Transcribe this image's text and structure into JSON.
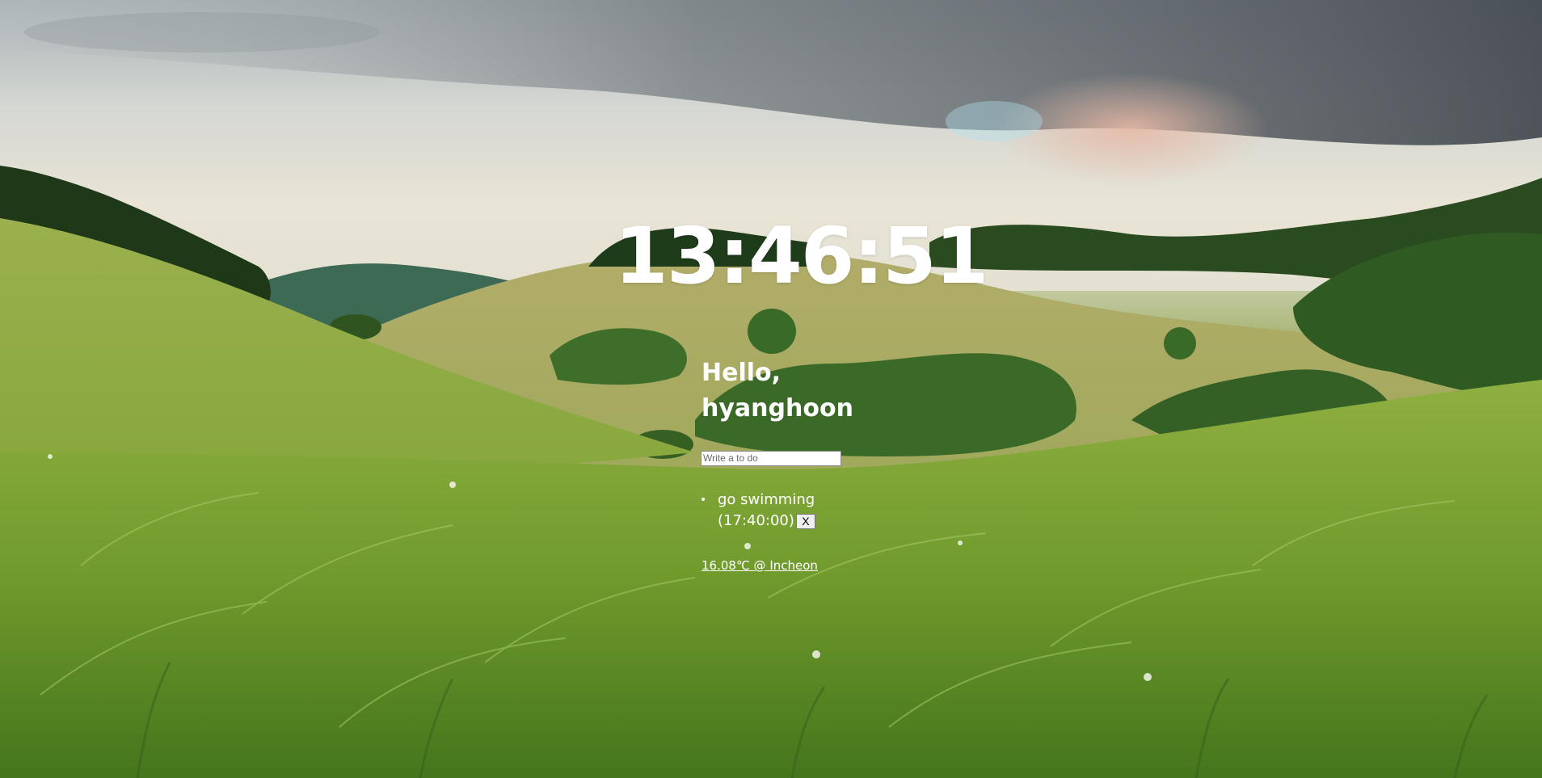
{
  "clock": {
    "time": "13:46:51"
  },
  "greeting": {
    "text": "Hello, hyanghoon"
  },
  "todo_form": {
    "placeholder": "Write a to do"
  },
  "todos": [
    {
      "text": "go swimming (17:40:00)",
      "delete_label": "X"
    }
  ],
  "weather": {
    "text": "16.08℃ @ Incheon"
  },
  "background": {
    "scene": "grassy-hills-landscape"
  }
}
